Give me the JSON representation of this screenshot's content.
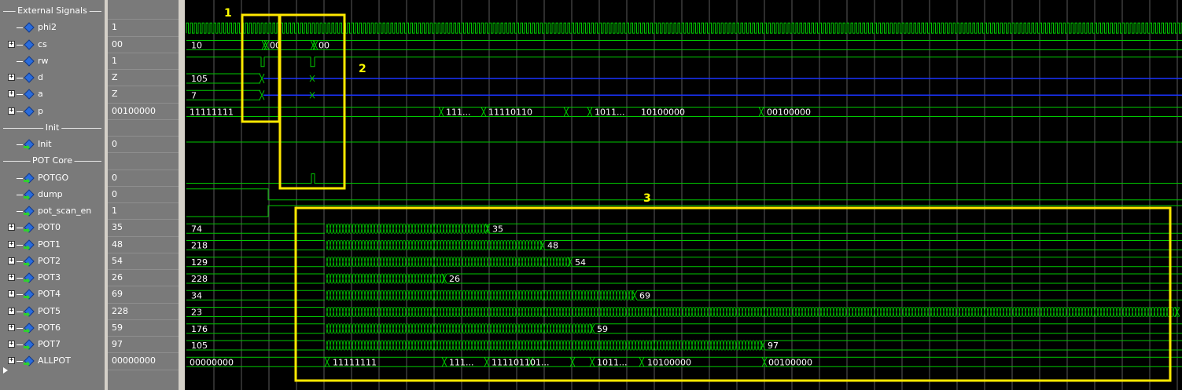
{
  "groups": [
    {
      "name": "External Signals"
    },
    {
      "name": "Init"
    },
    {
      "name": "POT Core"
    }
  ],
  "signals": [
    {
      "name": "phi2",
      "value": "1",
      "expandable": false
    },
    {
      "name": "cs",
      "value": "00",
      "expandable": true
    },
    {
      "name": "rw",
      "value": "1",
      "expandable": false
    },
    {
      "name": "d",
      "value": "Z",
      "expandable": true
    },
    {
      "name": "a",
      "value": "Z",
      "expandable": true
    },
    {
      "name": "p",
      "value": "00100000",
      "expandable": true
    },
    {
      "name": "Init",
      "value": "0",
      "expandable": false
    },
    {
      "name": "POTGO",
      "value": "0",
      "expandable": false
    },
    {
      "name": "dump",
      "value": "0",
      "expandable": false
    },
    {
      "name": "pot_scan_en",
      "value": "1",
      "expandable": false
    },
    {
      "name": "POT0",
      "value": "35",
      "expandable": true
    },
    {
      "name": "POT1",
      "value": "48",
      "expandable": true
    },
    {
      "name": "POT2",
      "value": "54",
      "expandable": true
    },
    {
      "name": "POT3",
      "value": "26",
      "expandable": true
    },
    {
      "name": "POT4",
      "value": "69",
      "expandable": true
    },
    {
      "name": "POT5",
      "value": "228",
      "expandable": true
    },
    {
      "name": "POT6",
      "value": "59",
      "expandable": true
    },
    {
      "name": "POT7",
      "value": "97",
      "expandable": true
    },
    {
      "name": "ALLPOT",
      "value": "00000000",
      "expandable": true
    }
  ],
  "waves": {
    "cs": {
      "start": "10",
      "labels": [
        "00",
        "00"
      ]
    },
    "d": {
      "start": "105"
    },
    "a": {
      "start": "7"
    },
    "p": {
      "start": "11111111",
      "labels": [
        "111...",
        "11110110",
        "1011...",
        "10100000",
        "00100000"
      ]
    },
    "pots": [
      {
        "start": "74",
        "end": "35"
      },
      {
        "start": "218",
        "end": "48"
      },
      {
        "start": "129",
        "end": "54"
      },
      {
        "start": "228",
        "end": "26"
      },
      {
        "start": "34",
        "end": "69"
      },
      {
        "start": "23",
        "end": ""
      },
      {
        "start": "176",
        "end": "59"
      },
      {
        "start": "105",
        "end": "97"
      }
    ],
    "allpot": {
      "start": "00000000",
      "labels": [
        "11111111",
        "111...",
        "11110110",
        "1...",
        "1011...",
        "10100000",
        "00100000"
      ]
    }
  },
  "annotations": [
    {
      "label": "1"
    },
    {
      "label": "2"
    },
    {
      "label": "3"
    }
  ],
  "colors": {
    "wave": "#00c800",
    "bus_z": "#1a33ff",
    "highlight": "#ffe800",
    "grid": "#5a5a5a",
    "panel": "#7a7a7a"
  }
}
